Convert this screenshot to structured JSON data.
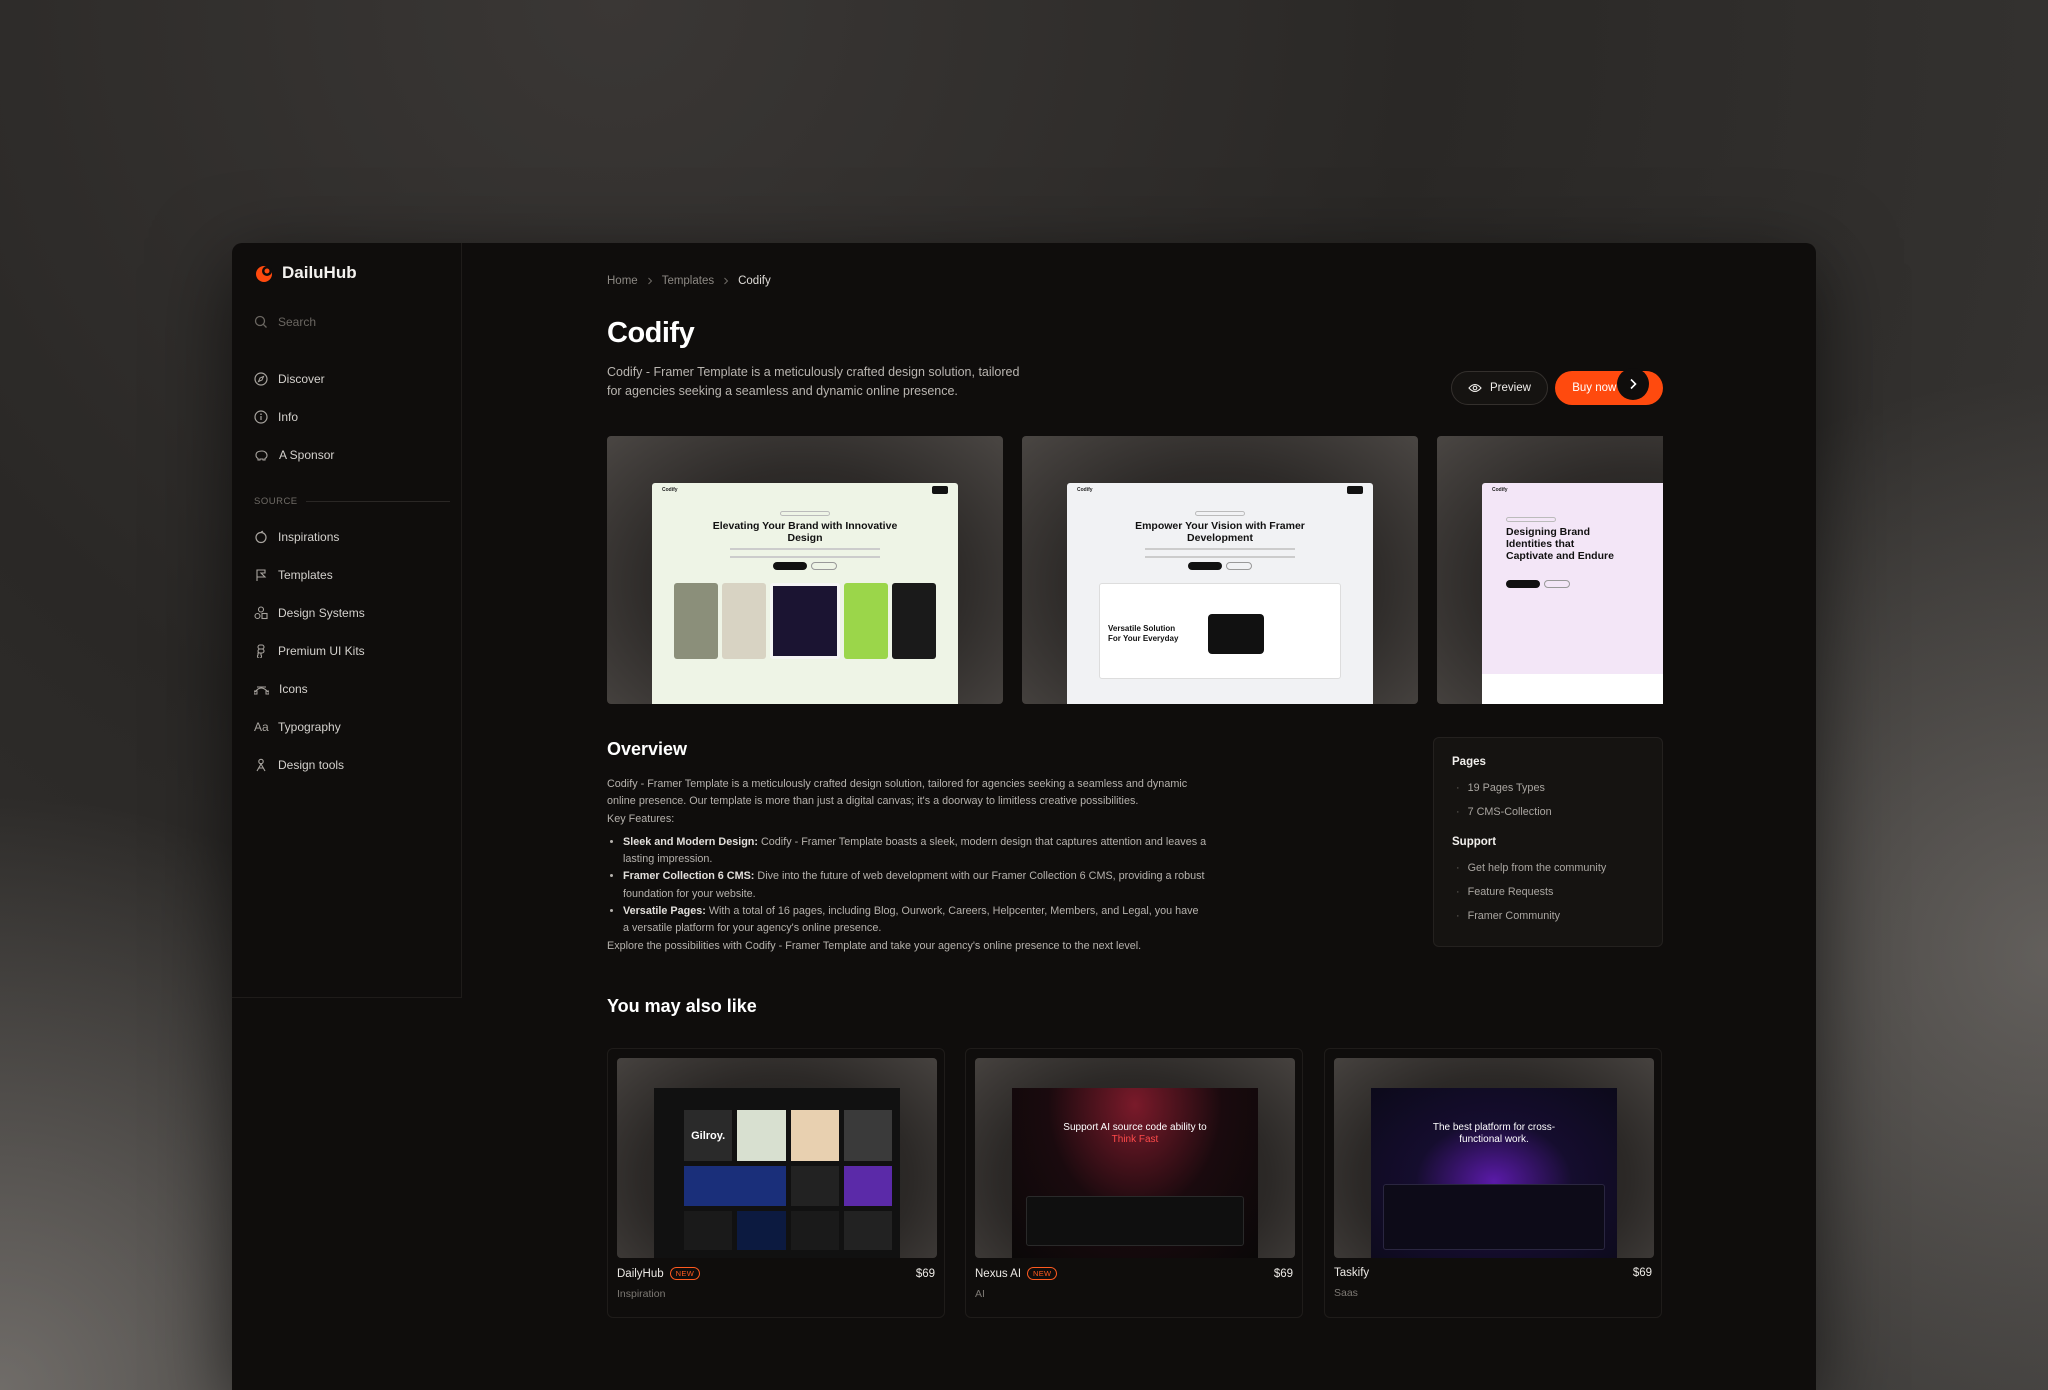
{
  "brand": {
    "name": "DailuHub"
  },
  "search": {
    "placeholder": "Search"
  },
  "nav_primary": [
    {
      "label": "Discover",
      "icon": "compass-icon"
    },
    {
      "label": "Info",
      "icon": "info-icon"
    },
    {
      "label": "A Sponsor",
      "icon": "piggy-bank-icon"
    }
  ],
  "source_label": "SOURCE",
  "nav_source": [
    {
      "label": "Inspirations",
      "icon": "bulb-icon"
    },
    {
      "label": "Templates",
      "icon": "template-icon"
    },
    {
      "label": "Design Systems",
      "icon": "shapes-icon"
    },
    {
      "label": "Premium UI Kits",
      "icon": "figma-icon"
    },
    {
      "label": "Icons",
      "icon": "pen-tool-icon"
    },
    {
      "label": "Typography",
      "icon": "type-icon"
    },
    {
      "label": "Design tools",
      "icon": "tools-icon"
    }
  ],
  "breadcrumb": [
    "Home",
    "Templates",
    "Codify"
  ],
  "product": {
    "title": "Codify",
    "description": "Codify - Framer Template is a meticulously crafted design solution, tailored for agencies seeking a seamless and dynamic online presence.",
    "preview_label": "Preview",
    "buy_label": "Buy now - $69"
  },
  "gallery": [
    {
      "heading": "Elevating Your Brand with Innovative Design",
      "brand": "Codify",
      "bg": "#eef4e6"
    },
    {
      "heading": "Empower Your Vision with Framer Development",
      "brand": "Codify",
      "bg": "#f1f2f4",
      "sub": "Versatile Solution For Your Everyday"
    },
    {
      "heading": "Designing Brand Identities that Captivate and Endure",
      "brand": "Codify",
      "bg": "#f3e6f7"
    }
  ],
  "overview": {
    "title": "Overview",
    "intro": "Codify - Framer Template is a meticulously crafted design solution, tailored for agencies seeking a seamless and dynamic online presence. Our template is more than just a digital canvas; it's a doorway to limitless creative possibilities.",
    "features_label": "Key Features:",
    "features": [
      {
        "bold": "Sleek and Modern Design:",
        "text": " Codify - Framer Template boasts a sleek, modern design that captures attention and leaves a lasting impression."
      },
      {
        "bold": "Framer Collection 6 CMS:",
        "text": " Dive into the future of web development with our Framer Collection 6 CMS, providing a robust foundation for your website."
      },
      {
        "bold": "Versatile Pages:",
        "text": " With a total of 16 pages, including Blog, Ourwork, Careers, Helpcenter, Members, and Legal, you have a versatile platform for your agency's online presence."
      }
    ],
    "outro": "Explore the possibilities with Codify - Framer Template and take your agency's online presence to the next level."
  },
  "info_card": {
    "pages_title": "Pages",
    "pages": [
      "19 Pages Types",
      "7 CMS-Collection"
    ],
    "support_title": "Support",
    "support": [
      "Get help from the community",
      "Feature Requests",
      "Framer Community"
    ]
  },
  "also_like": {
    "title": "You may also like",
    "items": [
      {
        "name": "DailyHub",
        "badge": "NEW",
        "price": "$69",
        "category": "Inspiration",
        "screen_text": "Gilroy."
      },
      {
        "name": "Nexus AI",
        "badge": "NEW",
        "price": "$69",
        "category": "AI",
        "screen_text": "Support AI source code ability to",
        "screen_accent": "Think Fast"
      },
      {
        "name": "Taskify",
        "badge": "",
        "price": "$69",
        "category": "Saas",
        "screen_text": "The best platform for cross-functional work."
      }
    ]
  },
  "colors": {
    "accent": "#ff4a0e",
    "background": "#0f0d0c"
  }
}
